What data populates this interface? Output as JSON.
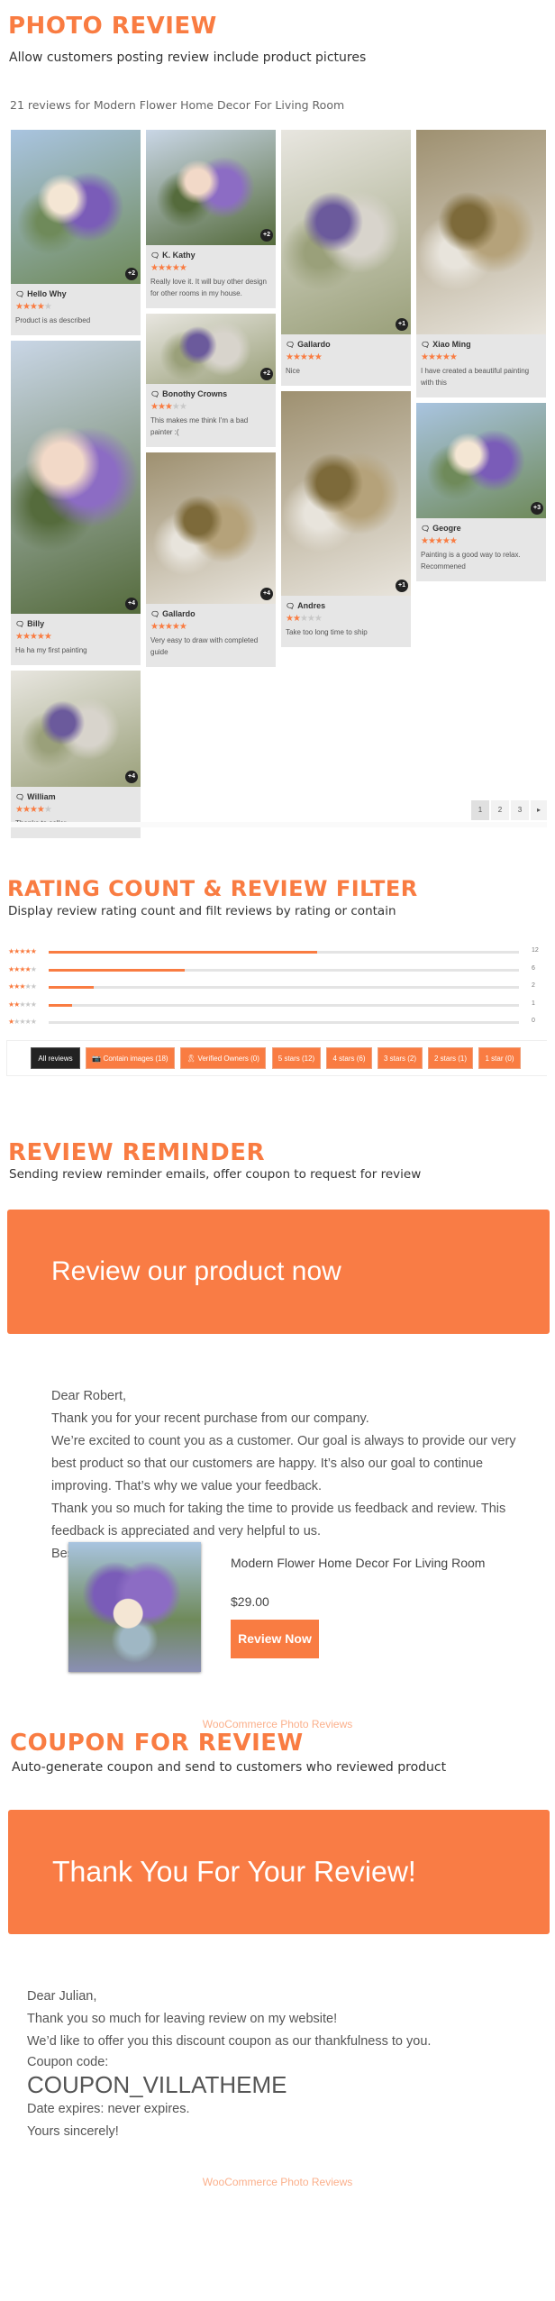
{
  "accent_color": "#f97c42",
  "photo_review": {
    "title": "PHOTO REVIEW",
    "subtitle": "Allow customers posting review include product pictures",
    "reviews_heading": "21 reviews for Modern Flower Home Decor For Living Room",
    "columns": [
      [
        {
          "name": "Hello Why",
          "rating": 4,
          "text": "Product is as described",
          "more": "+2"
        },
        {
          "name": "Billy",
          "rating": 5,
          "text": "Ha ha my first painting",
          "more": "+4"
        },
        {
          "name": "William",
          "rating": 4,
          "text": "Thanks to seller",
          "more": "+4"
        }
      ],
      [
        {
          "name": "K. Kathy",
          "rating": 5,
          "text": "Really love it. It will buy other design for other rooms in my house.",
          "more": "+2"
        },
        {
          "name": "Bonothy Crowns",
          "rating": 3,
          "text": "This makes me think I'm a bad painter :(",
          "more": "+2"
        },
        {
          "name": "Gallardo",
          "rating": 5,
          "text": "Very easy to draw with completed guide",
          "more": "+4"
        }
      ],
      [
        {
          "name": "Gallardo",
          "rating": 5,
          "text": "Nice",
          "more": "+1"
        },
        {
          "name": "Andres",
          "rating": 2,
          "text": "Take too long time to ship",
          "more": "+1"
        }
      ],
      [
        {
          "name": "Xiao Ming",
          "rating": 5,
          "text": "I have created a beautiful painting with this",
          "more": ""
        },
        {
          "name": "Geogre",
          "rating": 5,
          "text": "Painting is a good way to relax. Recommened",
          "more": "+3"
        }
      ]
    ],
    "pagination": {
      "pages": [
        "1",
        "2",
        "3"
      ],
      "current": "1",
      "next_icon": "caret-right-icon"
    }
  },
  "rating_filter": {
    "title": "RATING COUNT & REVIEW FILTER",
    "subtitle": "Display review rating count and filt reviews by rating or contain",
    "rows": [
      {
        "stars": 5,
        "count": "12",
        "percent": 57
      },
      {
        "stars": 4,
        "count": "6",
        "percent": 29
      },
      {
        "stars": 3,
        "count": "2",
        "percent": 9.5
      },
      {
        "stars": 2,
        "count": "1",
        "percent": 5
      },
      {
        "stars": 1,
        "count": "0",
        "percent": 0
      }
    ],
    "filters": [
      "All reviews",
      "Contain images (18)",
      "Verified Owners (0)",
      "5 stars (12)",
      "4 stars (6)",
      "3 stars (2)",
      "2 stars (1)",
      "1 star (0)"
    ],
    "active_filter": "All reviews"
  },
  "review_reminder": {
    "title": "REVIEW REMINDER",
    "subtitle": "Sending review reminder emails, offer coupon to request for review",
    "banner": "Review our product now",
    "letter": [
      "Dear Robert,",
      "Thank you for your recent purchase from our company.",
      "We’re excited to count you as a customer. Our goal is always to provide our very best product so that our customers are happy. It’s also our goal to continue improving. That’s why we value your feedback.",
      "Thank you so much for taking the time to provide us feedback and review. This feedback is appreciated and very helpful to us.",
      "Best regards!"
    ],
    "product": {
      "name": "Modern Flower Home Decor For Living Room",
      "price": "$29.00",
      "button": "Review Now"
    },
    "footer": "WooCommerce Photo Reviews"
  },
  "coupon": {
    "title": "COUPON FOR REVIEW",
    "subtitle": "Auto-generate coupon and send to customers who reviewed product",
    "banner": "Thank You For Your Review!",
    "greeting": "Dear Julian,",
    "line1": "Thank you so much for leaving review on my website!",
    "line2": "We’d like to offer you this discount coupon as our thankfulness to you.",
    "code_label": "Coupon code:",
    "code": "COUPON_VILLATHEME",
    "expires": "Date expires: never expires.",
    "closing": "Yours sincerely!",
    "footer": "WooCommerce Photo Reviews"
  }
}
